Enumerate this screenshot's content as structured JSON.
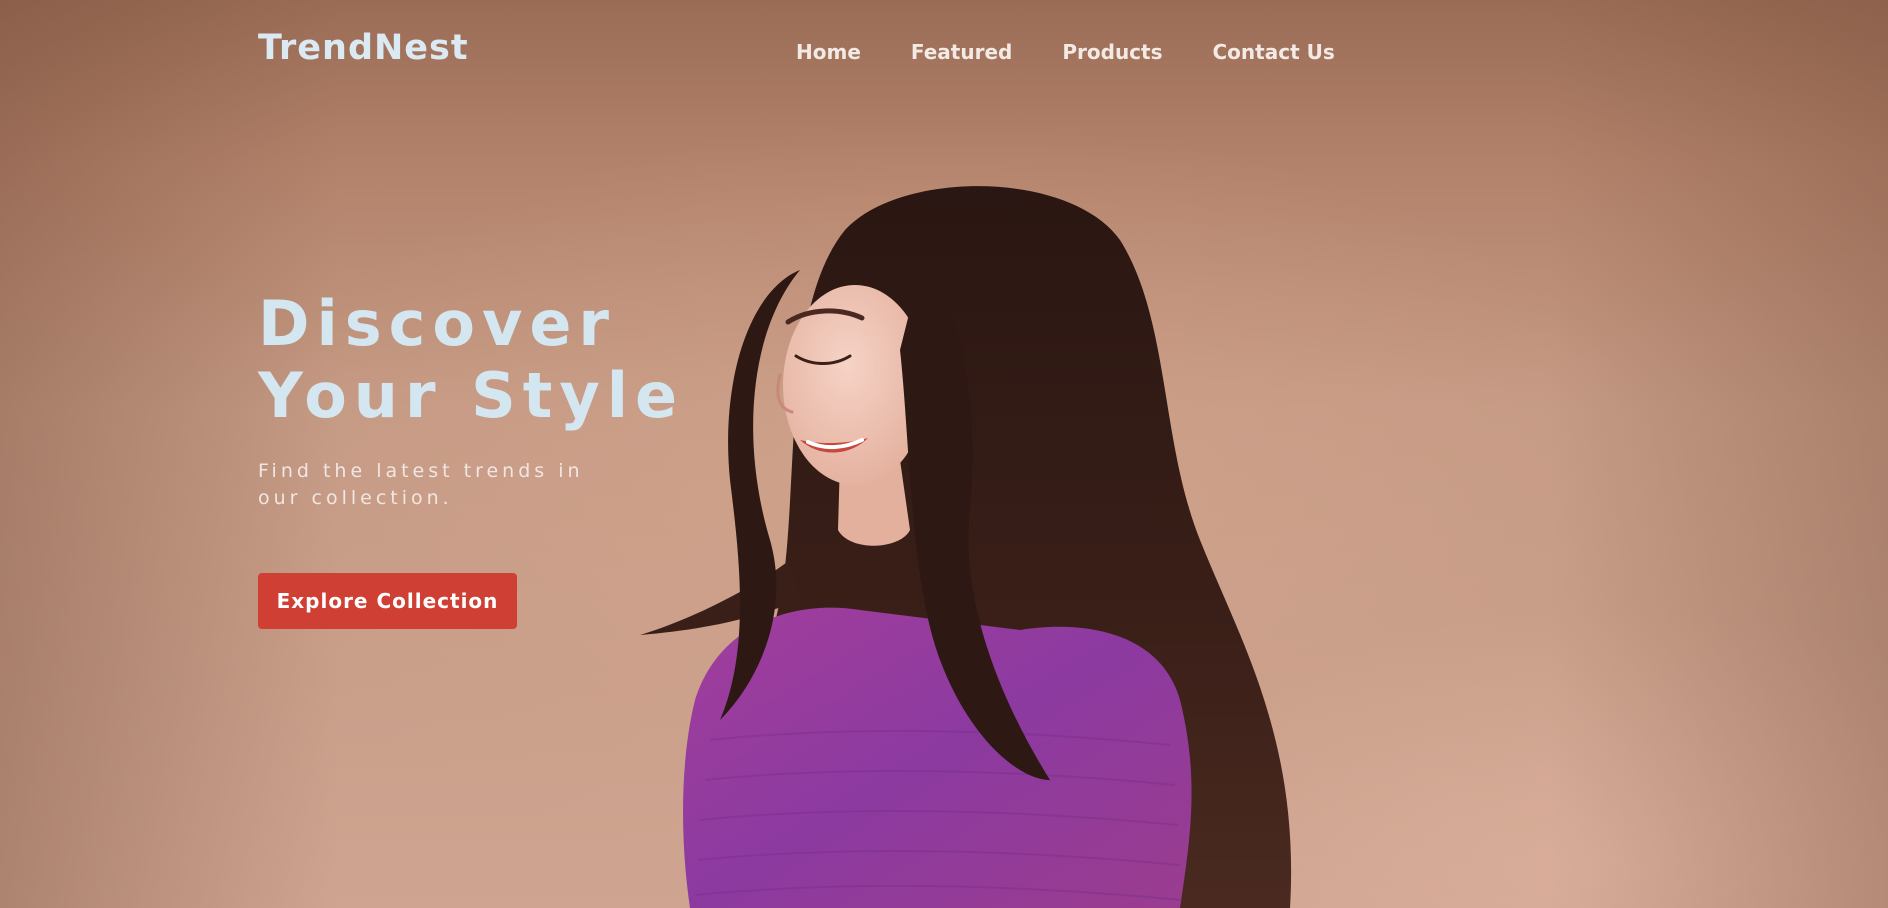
{
  "brand": {
    "name": "TrendNest"
  },
  "nav": {
    "items": [
      {
        "label": "Home"
      },
      {
        "label": "Featured"
      },
      {
        "label": "Products"
      },
      {
        "label": "Contact Us"
      }
    ]
  },
  "hero": {
    "title": "Discover Your Style",
    "subtitle": "Find the latest trends in our collection.",
    "cta_label": "Explore Collection",
    "image_subject": "woman-in-purple-sweater"
  },
  "colors": {
    "background": "#c59a84",
    "logo_text": "#dbe9f3",
    "title_text": "#d4e6f0",
    "nav_text": "#f3eae6",
    "cta_background": "#d03f33",
    "cta_text": "#ffffff"
  }
}
